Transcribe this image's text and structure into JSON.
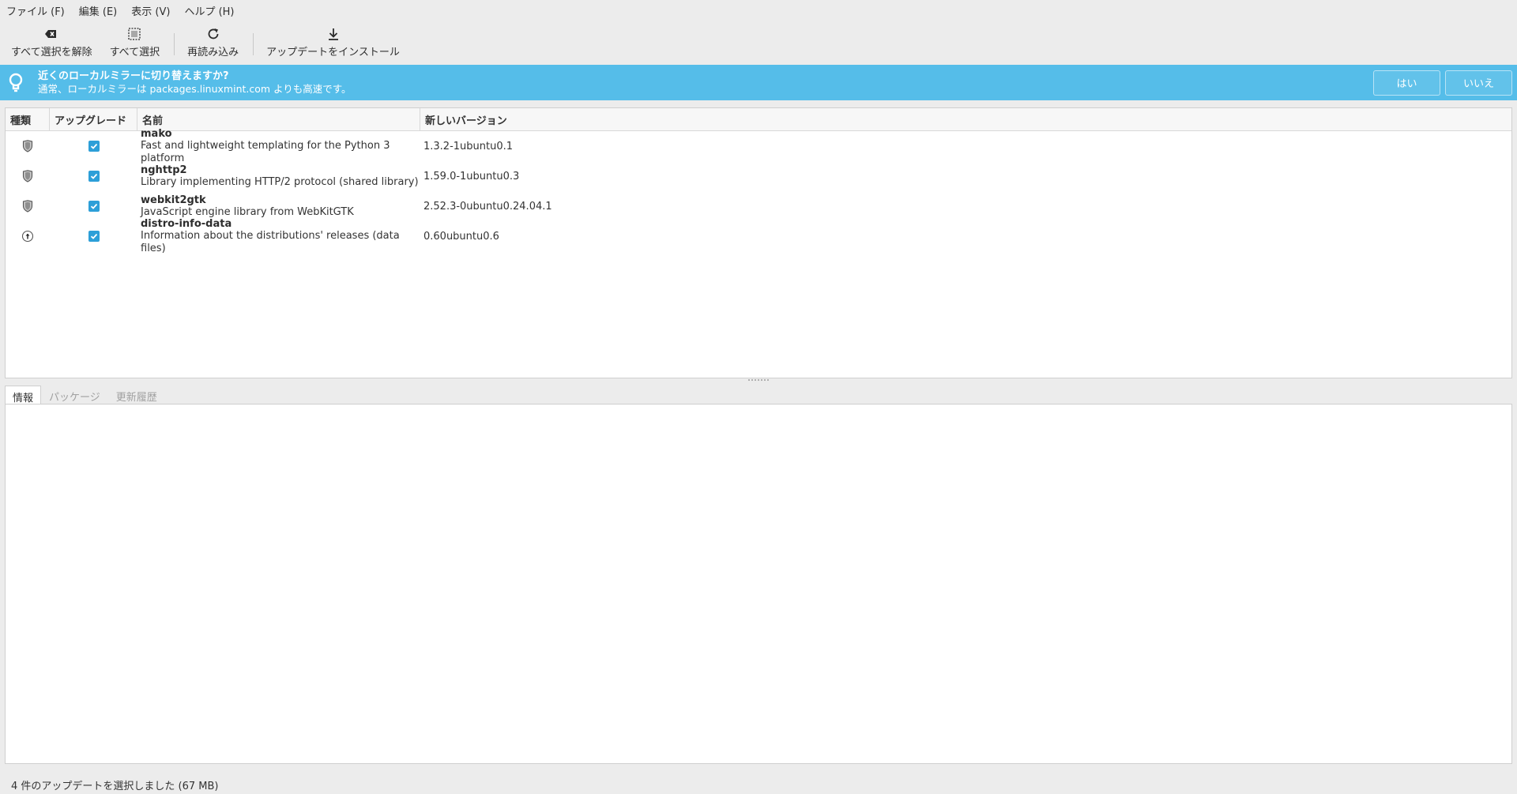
{
  "menubar": {
    "items": [
      "ファイル (F)",
      "編集 (E)",
      "表示 (V)",
      "ヘルプ (H)"
    ]
  },
  "toolbar": {
    "clear_label": "すべて選択を解除",
    "select_all_label": "すべて選択",
    "refresh_label": "再読み込み",
    "install_label": "アップデートをインストール"
  },
  "infobar": {
    "title": "近くのローカルミラーに切り替えますか?",
    "subtitle": "通常、ローカルミラーは packages.linuxmint.com よりも高速です。",
    "yes_label": "はい",
    "no_label": "いいえ",
    "color": "#55bde9"
  },
  "updates": {
    "headers": {
      "type": "種類",
      "upgrade": "アップグレード",
      "name": "名前",
      "version": "新しいバージョン"
    },
    "rows": [
      {
        "icon": "shield-icon",
        "checked": true,
        "name": "mako",
        "description": "Fast and lightweight templating for the Python 3 platform",
        "version": "1.3.2-1ubuntu0.1"
      },
      {
        "icon": "shield-icon",
        "checked": true,
        "name": "nghttp2",
        "description": "Library implementing HTTP/2 protocol (shared library)",
        "version": "1.59.0-1ubuntu0.3"
      },
      {
        "icon": "shield-icon",
        "checked": true,
        "name": "webkit2gtk",
        "description": "JavaScript engine library from WebKitGTK",
        "version": "2.52.3-0ubuntu0.24.04.1"
      },
      {
        "icon": "up-arrow-icon",
        "checked": true,
        "name": "distro-info-data",
        "description": "Information about the distributions' releases (data files)",
        "version": "0.60ubuntu0.6"
      }
    ]
  },
  "tabs": {
    "info": "情報",
    "packages": "パッケージ",
    "history": "更新履歴"
  },
  "status": {
    "text": "4 件のアップデートを選択しました (67 MB)"
  },
  "colors": {
    "checkbox": "#2d9fd8"
  }
}
